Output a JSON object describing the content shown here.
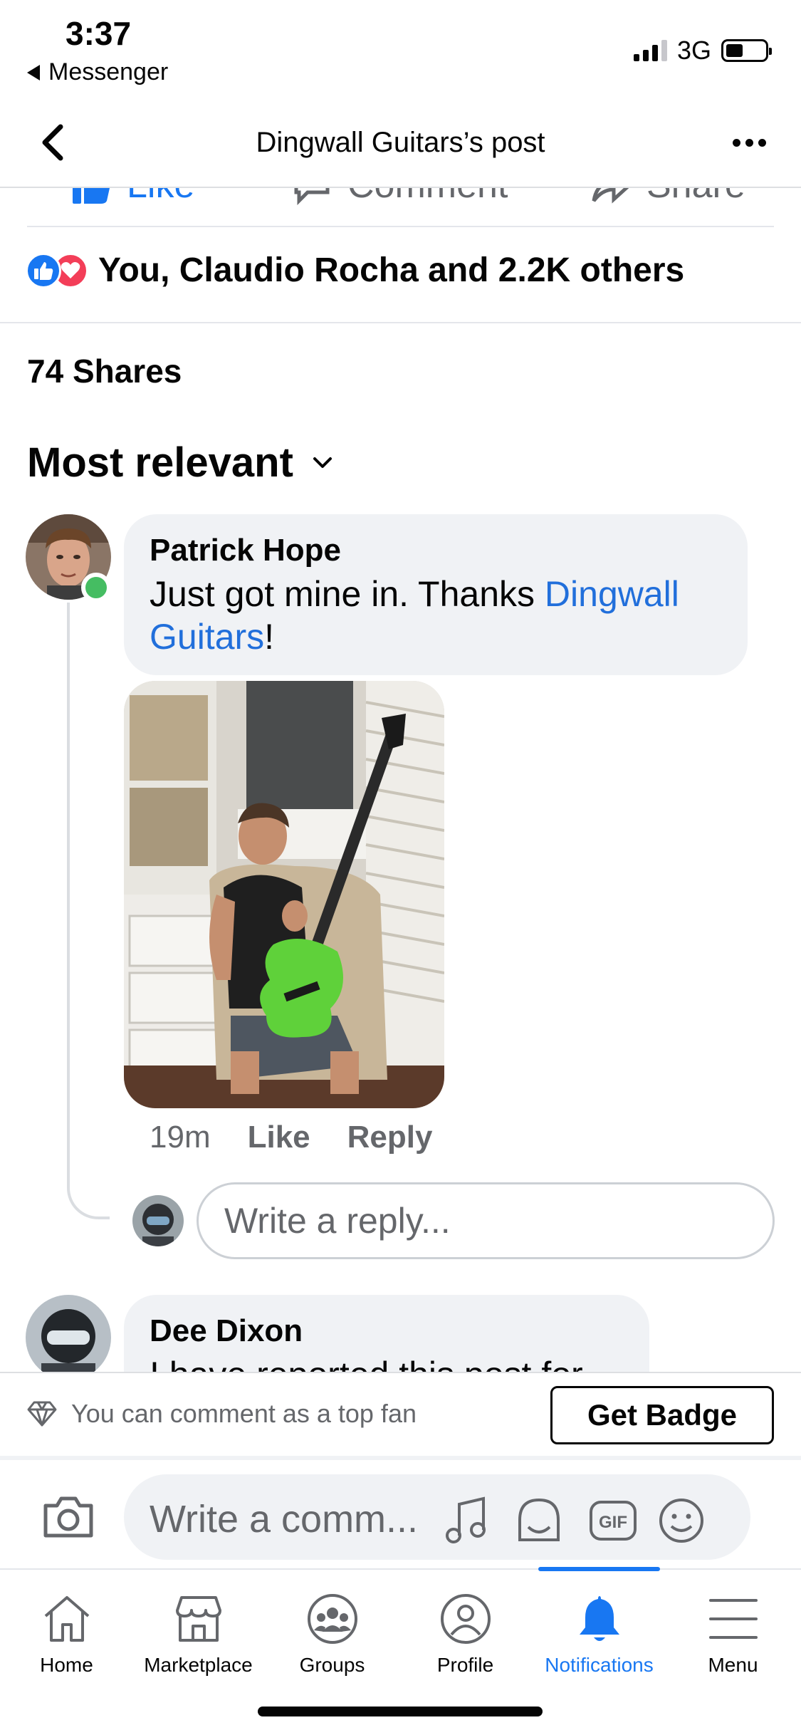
{
  "status_bar": {
    "time": "3:37",
    "back_app": "Messenger",
    "network": "3G",
    "battery_level": 0.45
  },
  "header": {
    "title": "Dingwall Guitars’s post"
  },
  "post_actions": {
    "like": "Like",
    "comment": "Comment",
    "share": "Share"
  },
  "reactions": {
    "summary": "You, Claudio Rocha and 2.2K others"
  },
  "shares": "74 Shares",
  "sort": {
    "label": "Most relevant"
  },
  "comments": [
    {
      "author": "Patrick Hope",
      "text_before": "Just got mine in. Thanks ",
      "mention": "Dingwall Guitars",
      "text_after": "!",
      "time": "19m",
      "like_label": "Like",
      "reply_label": "Reply",
      "online": true
    },
    {
      "author": "Dee Dixon",
      "text_before": "I have reported this post for"
    }
  ],
  "reply_input": {
    "placeholder": "Write a reply..."
  },
  "fan_bar": {
    "text": "You can comment as a top fan",
    "button": "Get Badge"
  },
  "composer": {
    "placeholder": "Write a comm..."
  },
  "tabs": [
    {
      "label": "Home",
      "icon": "home-icon"
    },
    {
      "label": "Marketplace",
      "icon": "marketplace-icon"
    },
    {
      "label": "Groups",
      "icon": "groups-icon"
    },
    {
      "label": "Profile",
      "icon": "profile-icon"
    },
    {
      "label": "Notifications",
      "icon": "bell-icon",
      "active": true
    },
    {
      "label": "Menu",
      "icon": "menu-icon"
    }
  ],
  "colors": {
    "accent": "#1877f2",
    "love": "#f33e58",
    "online": "#45bd62",
    "bubble": "#f0f2f5",
    "link": "#216fdb"
  }
}
